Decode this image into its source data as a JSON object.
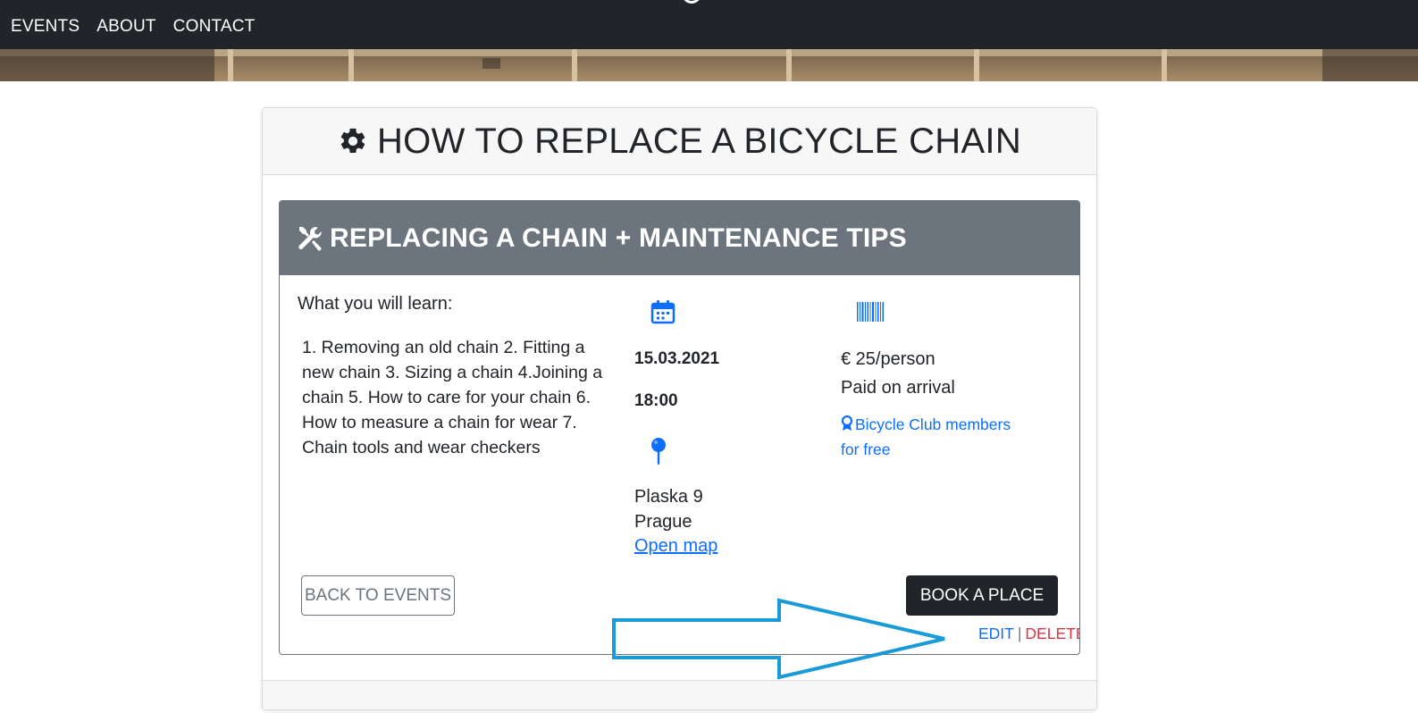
{
  "nav": {
    "items": [
      {
        "label": "EVENTS"
      },
      {
        "label": "ABOUT"
      },
      {
        "label": "CONTACT"
      }
    ]
  },
  "page": {
    "title": "HOW TO REPLACE A BICYCLE CHAIN",
    "title_icon": "gear-icon"
  },
  "event": {
    "title": "REPLACING A CHAIN + MAINTENANCE TIPS",
    "title_icon": "tools-icon",
    "learn_label": "What you will learn:",
    "learn_text": "1. Removing an old chain 2. Fitting a new chain 3. Sizing a chain 4.Joining a chain 5. How to care for your chain 6. How to measure a chain for wear 7. Chain tools and wear checkers",
    "date": "15.03.2021",
    "time": "18:00",
    "address_line1": "Plaska 9",
    "address_line2": "Prague",
    "map_link": "Open map",
    "price": "€ 25/person",
    "payment": "Paid on arrival",
    "members_note": "Bicycle Club members for free"
  },
  "actions": {
    "back_label": "BACK TO EVENTS",
    "book_label": "BOOK A PLACE",
    "edit_label": "EDIT",
    "separator": "|",
    "delete_label": "DELETE"
  },
  "colors": {
    "navbar": "#212529",
    "card_header": "#6c757d",
    "link": "#0d6efd",
    "danger": "#dc3545",
    "annotation_arrow": "#1a9ad6"
  }
}
